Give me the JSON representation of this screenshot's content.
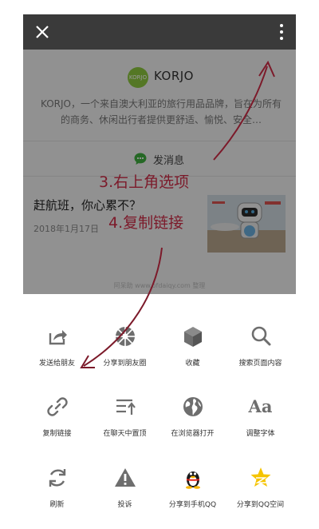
{
  "topbar": {
    "close_icon": "close-icon",
    "more_icon": "more-vertical-icon",
    "background": "#3a3a3a"
  },
  "profile": {
    "logo_text": "KORJO",
    "name": "KORJO",
    "description": "KORJO，一个来自澳大利亚的旅行用品品牌，旨在为所有的商务、休闲出行者提供更舒适、愉悦、安全…",
    "send_message": "发消息"
  },
  "article": {
    "title": "赶航班，你心累不？",
    "date": "2018年1月17日"
  },
  "watermark": "阿呆助 www.ofdaiqy.com 整理",
  "share_rows": [
    [
      {
        "label": "发送给朋友",
        "icon": "share-to-friend-icon"
      },
      {
        "label": "分享到朋友圈",
        "icon": "moments-icon"
      },
      {
        "label": "收藏",
        "icon": "favorite-cube-icon"
      },
      {
        "label": "搜索页面内容",
        "icon": "search-icon"
      }
    ],
    [
      {
        "label": "复制链接",
        "icon": "link-icon"
      },
      {
        "label": "在聊天中置顶",
        "icon": "pin-to-top-icon"
      },
      {
        "label": "在浏览器打开",
        "icon": "globe-icon"
      },
      {
        "label": "调整字体",
        "icon": "font-size-icon"
      }
    ],
    [
      {
        "label": "刷新",
        "icon": "refresh-icon"
      },
      {
        "label": "投诉",
        "icon": "warning-icon"
      },
      {
        "label": "分享到手机QQ",
        "icon": "qq-icon"
      },
      {
        "label": "分享到QQ空间",
        "icon": "qzone-icon"
      }
    ]
  ],
  "annotations": {
    "step3": "3.右上角选项",
    "step4": "4.复制链接",
    "color": "#7c1a2a"
  }
}
